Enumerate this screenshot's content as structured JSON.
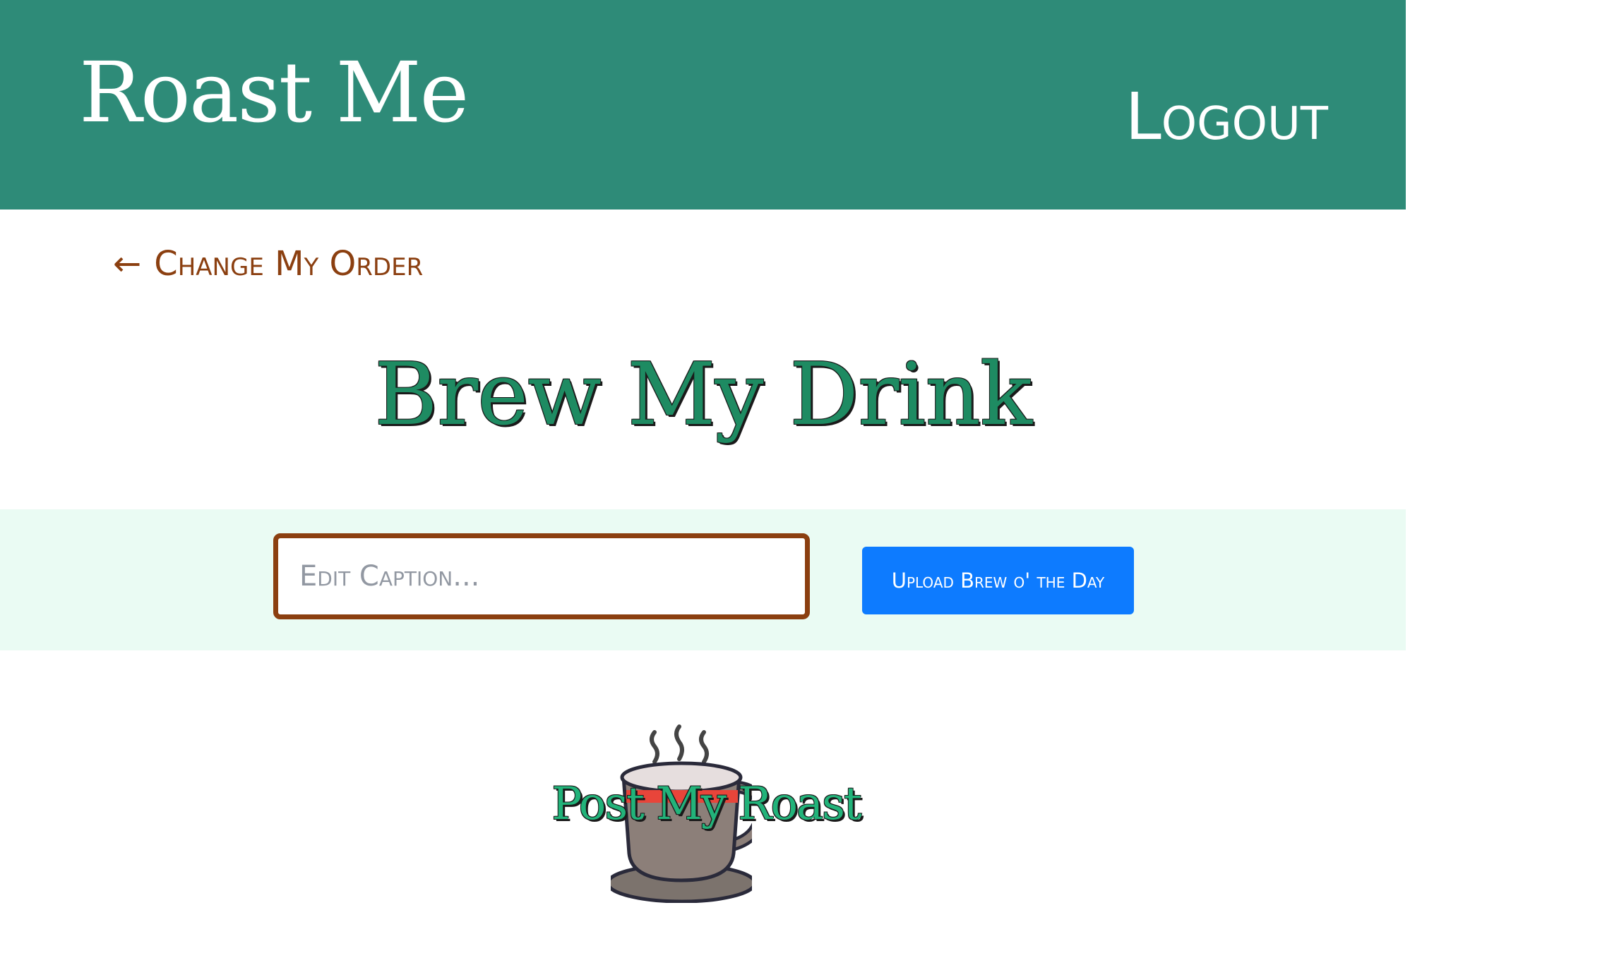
{
  "header": {
    "brand": "Roast Me",
    "logout_label": "Logout"
  },
  "nav": {
    "back_arrow": "←",
    "back_label": "Change My Order"
  },
  "main": {
    "title": "Brew My Drink"
  },
  "form": {
    "caption_placeholder": "Edit Caption...",
    "caption_value": "",
    "upload_label": "Upload Brew o' the Day"
  },
  "post": {
    "label": "Post My Roast",
    "icon": "coffee-cup-icon"
  },
  "colors": {
    "navbar": "#2e8b78",
    "accent_brown": "#8b3f10",
    "title_green": "#1e8b62",
    "band": "#eafbf3",
    "button_blue": "#0d7bff"
  }
}
